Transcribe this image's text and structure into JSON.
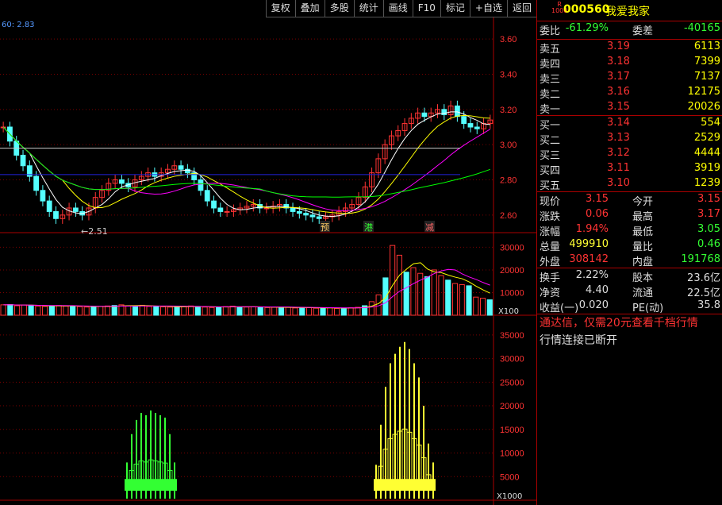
{
  "toolbar": [
    "复权",
    "叠加",
    "多股",
    "统计",
    "画线",
    "F10",
    "标记",
    "+自选",
    "返回"
  ],
  "indicator_label": "60: 2.83",
  "chart_data": [
    {
      "type": "candlestick",
      "yaxis_ticks": [
        "3.60",
        "3.40",
        "3.20",
        "3.00",
        "2.80",
        "2.60"
      ],
      "ylim": [
        2.5,
        3.7
      ],
      "annotations": [
        {
          "text": "←2.51",
          "value": 2.51
        },
        {
          "text": "预",
          "kind": "event"
        },
        {
          "text": "港",
          "kind": "event"
        },
        {
          "text": "减",
          "kind": "event"
        }
      ],
      "close": [
        3.1,
        3.02,
        2.94,
        2.88,
        2.82,
        2.74,
        2.68,
        2.62,
        2.58,
        2.6,
        2.64,
        2.62,
        2.6,
        2.64,
        2.7,
        2.74,
        2.78,
        2.8,
        2.78,
        2.76,
        2.8,
        2.82,
        2.84,
        2.82,
        2.84,
        2.86,
        2.88,
        2.86,
        2.84,
        2.8,
        2.74,
        2.68,
        2.64,
        2.62,
        2.62,
        2.63,
        2.64,
        2.65,
        2.66,
        2.64,
        2.64,
        2.65,
        2.66,
        2.64,
        2.62,
        2.61,
        2.6,
        2.59,
        2.58,
        2.59,
        2.6,
        2.62,
        2.64,
        2.66,
        2.7,
        2.76,
        2.84,
        2.92,
        3.0,
        3.05,
        3.08,
        3.12,
        3.15,
        3.18,
        3.16,
        3.18,
        3.2,
        3.17,
        3.22,
        3.16,
        3.12,
        3.1,
        3.09,
        3.12,
        3.14
      ],
      "colors": {
        "up": "#ff3333",
        "down": "#54ffff",
        "ma5": "#ffffff",
        "ma10": "#ffff00",
        "ma20": "#ff00ff",
        "ma60": "#00ff00",
        "hline": "#cccccc",
        "hline2": "#2222dd"
      }
    },
    {
      "type": "bar",
      "name": "volume",
      "yaxis_ticks": [
        "30000",
        "20000",
        "10000"
      ],
      "ylim": [
        0,
        34000
      ],
      "unit_label": "X100",
      "values": [
        4600,
        4700,
        4200,
        4500,
        4400,
        4000,
        3900,
        4100,
        4300,
        4000,
        4200,
        3800,
        3600,
        3700,
        3900,
        4100,
        4300,
        4600,
        4200,
        4000,
        4400,
        3900,
        3800,
        3700,
        3600,
        3700,
        3900,
        4100,
        3800,
        3600,
        3400,
        3600,
        3800,
        4000,
        3700,
        3600,
        3700,
        3600,
        3400,
        3500,
        3400,
        3500,
        3200,
        3300,
        3400,
        3100,
        3200,
        3300,
        3000,
        3200,
        3300,
        3500,
        4200,
        6000,
        9000,
        16500,
        30800,
        26500,
        19000,
        21000,
        18500,
        17000,
        20000,
        17500,
        15500,
        14000,
        13500,
        13000,
        8000,
        7500,
        6800
      ]
    },
    {
      "type": "bar",
      "name": "chip-distribution",
      "yaxis_ticks": [
        "35000",
        "30000",
        "25000",
        "20000",
        "15000",
        "10000",
        "5000"
      ],
      "ylim": [
        0,
        38000
      ],
      "unit_label": "X1000",
      "green_bars": [
        8000,
        14000,
        17000,
        18500,
        18000,
        19000,
        18500,
        18000,
        17500,
        14000,
        8000
      ],
      "yellow_bars": [
        7500,
        16000,
        24000,
        29000,
        31000,
        32500,
        33500,
        32000,
        29000,
        26000,
        20000,
        12000,
        8000
      ]
    }
  ],
  "panel": {
    "r_badge": "R\n1000",
    "code": "000560",
    "name": "我爱我家",
    "ratio_label": "委比",
    "ratio_value": "-61.29%",
    "diff_label": "委差",
    "diff_value": "-40165",
    "sells": [
      {
        "label": "卖五",
        "price": "3.19",
        "qty": "6113"
      },
      {
        "label": "卖四",
        "price": "3.18",
        "qty": "7399"
      },
      {
        "label": "卖三",
        "price": "3.17",
        "qty": "7137"
      },
      {
        "label": "卖二",
        "price": "3.16",
        "qty": "12175"
      },
      {
        "label": "卖一",
        "price": "3.15",
        "qty": "20026"
      }
    ],
    "buys": [
      {
        "label": "买一",
        "price": "3.14",
        "qty": "554"
      },
      {
        "label": "买二",
        "price": "3.13",
        "qty": "2529"
      },
      {
        "label": "买三",
        "price": "3.12",
        "qty": "4444"
      },
      {
        "label": "买四",
        "price": "3.11",
        "qty": "3919"
      },
      {
        "label": "买五",
        "price": "3.10",
        "qty": "1239"
      }
    ],
    "quote": [
      {
        "l1": "现价",
        "v1": "3.15",
        "c1": "red",
        "l2": "今开",
        "v2": "3.15",
        "c2": "red"
      },
      {
        "l1": "涨跌",
        "v1": "0.06",
        "c1": "red",
        "l2": "最高",
        "v2": "3.17",
        "c2": "red"
      },
      {
        "l1": "涨幅",
        "v1": "1.94%",
        "c1": "red",
        "l2": "最低",
        "v2": "3.05",
        "c2": "green"
      },
      {
        "l1": "总量",
        "v1": "499910",
        "c1": "yel",
        "l2": "量比",
        "v2": "0.46",
        "c2": "green"
      },
      {
        "l1": "外盘",
        "v1": "308142",
        "c1": "red",
        "l2": "内盘",
        "v2": "191768",
        "c2": "green"
      }
    ],
    "fund": [
      {
        "l1": "换手",
        "v1": "2.22%",
        "l2": "股本",
        "v2": "23.6亿"
      },
      {
        "l1": "净资",
        "v1": "4.40",
        "l2": "流通",
        "v2": "22.5亿"
      },
      {
        "l1": "收益(一)",
        "v1": "0.020",
        "l2": "PE(动)",
        "v2": "35.8"
      }
    ],
    "msg1": "通达信，仅需20元查看千档行情",
    "msg2": "行情连接已断开"
  }
}
